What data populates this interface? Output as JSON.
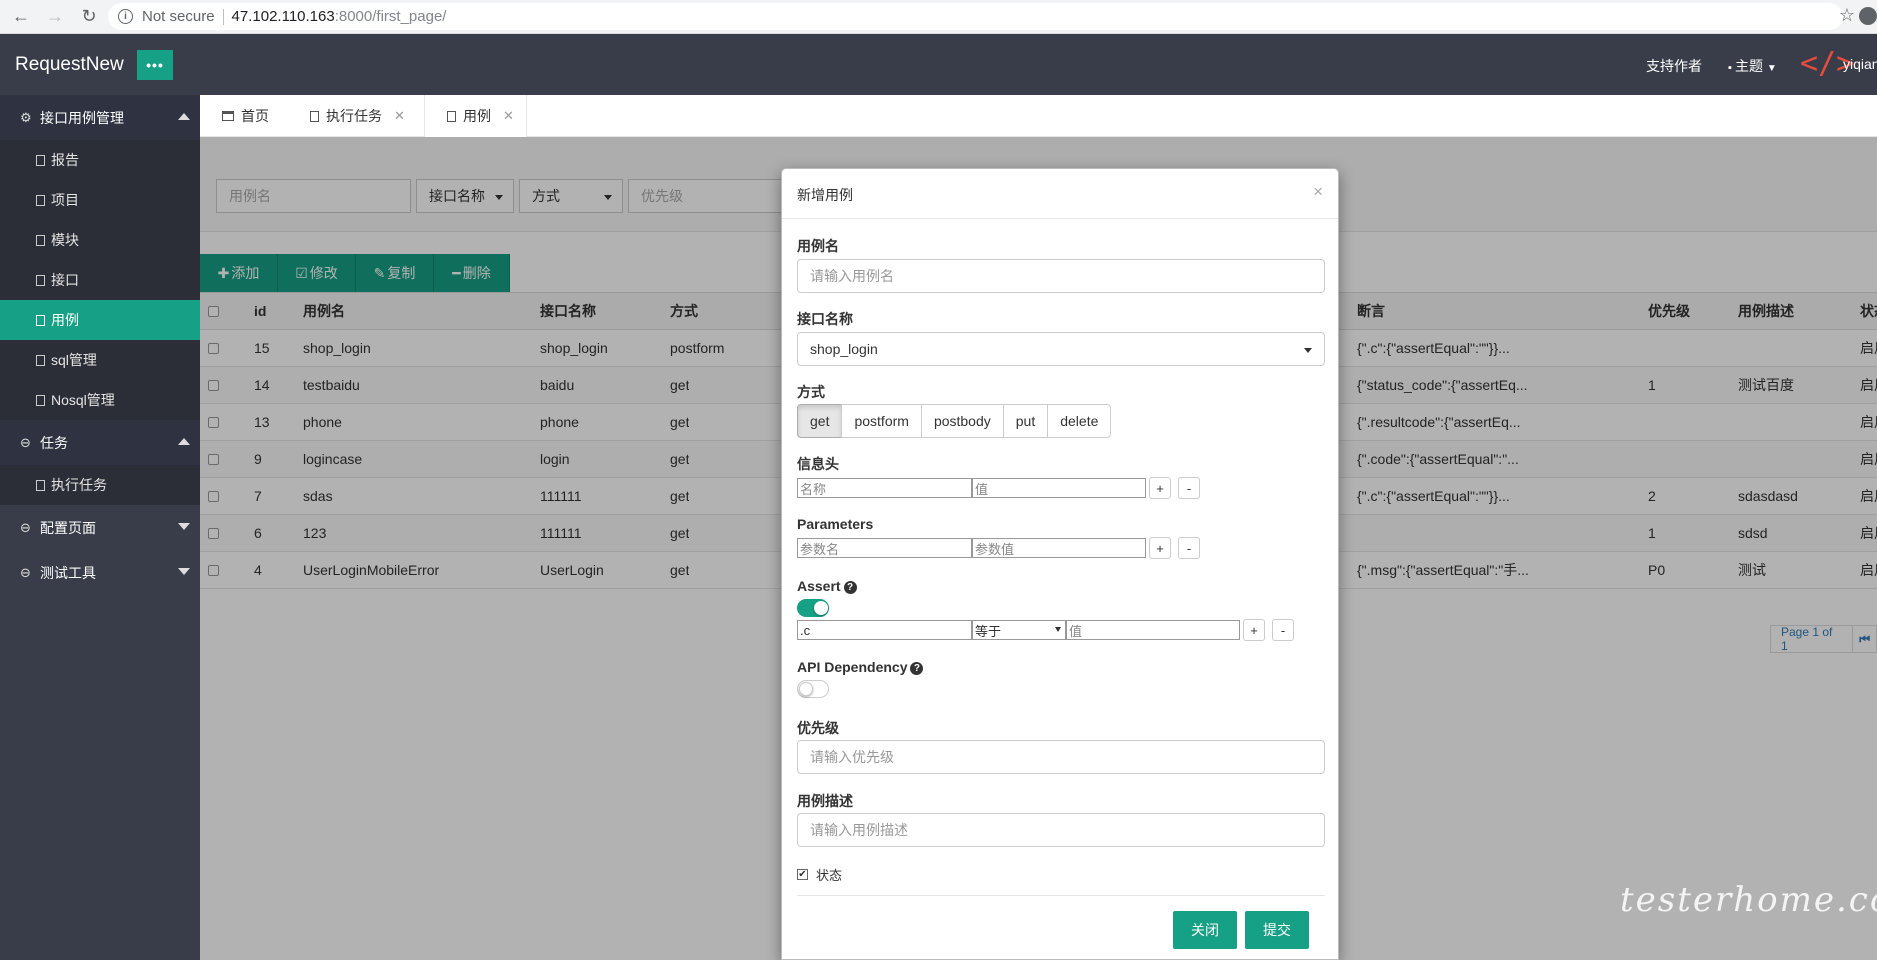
{
  "browser": {
    "not_secure": "Not secure",
    "url_host": "47.102.110.163",
    "url_path": ":8000/first_page/"
  },
  "header": {
    "brand": "RequestNew",
    "menu_toggle": "•••",
    "support": "支持作者",
    "theme": "主题",
    "logo_glyph": "</>",
    "user": "yiqian"
  },
  "sidebar": {
    "groups": [
      {
        "label": "接口用例管理",
        "items": [
          "报告",
          "项目",
          "模块",
          "接口",
          "用例",
          "sql管理",
          "Nosql管理"
        ]
      },
      {
        "label": "任务",
        "items": [
          "执行任务"
        ]
      },
      {
        "label": "配置页面"
      },
      {
        "label": "测试工具"
      }
    ]
  },
  "tabs": [
    {
      "label": "首页"
    },
    {
      "label": "执行任务"
    },
    {
      "label": "用例"
    }
  ],
  "filter": {
    "case_name_placeholder": "用例名",
    "api_name": "接口名称",
    "method": "方式",
    "priority_placeholder": "优先级"
  },
  "toolbar": {
    "add": "添加",
    "edit": "修改",
    "copy": "复制",
    "delete": "删除"
  },
  "table": {
    "headers": {
      "id": "id",
      "name": "用例名",
      "api": "接口名称",
      "method": "方式",
      "assert": "断言",
      "priority": "优先级",
      "desc": "用例描述",
      "status": "状态"
    },
    "rows": [
      {
        "id": "15",
        "name": "shop_login",
        "api": "shop_login",
        "method": "postform",
        "assert": "{\".c\":{\"assertEqual\":\"\"}}...",
        "priority": "",
        "desc": "",
        "status": "启用"
      },
      {
        "id": "14",
        "name": "testbaidu",
        "api": "baidu",
        "method": "get",
        "assert": "{\"status_code\":{\"assertEq...",
        "priority": "1",
        "desc": "测试百度",
        "status": "启用"
      },
      {
        "id": "13",
        "name": "phone",
        "api": "phone",
        "method": "get",
        "assert": "{\".resultcode\":{\"assertEq...",
        "priority": "",
        "desc": "",
        "status": "启用"
      },
      {
        "id": "9",
        "name": "logincase",
        "api": "login",
        "method": "get",
        "assert": "{\".code\":{\"assertEqual\":\"...",
        "priority": "",
        "desc": "",
        "status": "启用"
      },
      {
        "id": "7",
        "name": "sdas",
        "api": "111111",
        "method": "get",
        "assert": "{\".c\":{\"assertEqual\":\"\"}}...",
        "priority": "2",
        "desc": "sdasdasd",
        "status": "启用"
      },
      {
        "id": "6",
        "name": "123",
        "api": "111111",
        "method": "get",
        "assert": "",
        "priority": "1",
        "desc": "sdsd",
        "status": "启用"
      },
      {
        "id": "4",
        "name": "UserLoginMobileError",
        "api": "UserLogin",
        "method": "get",
        "assert": "{\".msg\":{\"assertEqual\":\"手...",
        "priority": "P0",
        "desc": "测试",
        "status": "启用"
      }
    ]
  },
  "pager": {
    "text": "Page 1 of 1",
    "first": "⏮"
  },
  "modal": {
    "title": "新增用例",
    "close": "×",
    "case_name_label": "用例名",
    "case_name_placeholder": "请输入用例名",
    "api_label": "接口名称",
    "api_value": "shop_login",
    "method_label": "方式",
    "methods": [
      "get",
      "postform",
      "postbody",
      "put",
      "delete"
    ],
    "selected_method": "get",
    "headers_label": "信息头",
    "header_name_placeholder": "名称",
    "header_value_placeholder": "值",
    "params_label": "Parameters",
    "param_name_placeholder": "参数名",
    "param_value_placeholder": "参数值",
    "assert_label": "Assert",
    "assert_enabled": true,
    "assert_key": ".c",
    "assert_op": "等于",
    "assert_value_placeholder": "值",
    "dep_label": "API Dependency",
    "dep_enabled": false,
    "priority_label": "优先级",
    "priority_placeholder": "请输入优先级",
    "desc_label": "用例描述",
    "desc_placeholder": "请输入用例描述",
    "status_label": "状态",
    "status_checked": true,
    "plus": "+",
    "minus": "-",
    "help": "?",
    "close_btn": "关闭",
    "submit_btn": "提交"
  },
  "watermark": "testerhome.com",
  "colors": {
    "accent": "#16a085",
    "header_bg": "#393d49"
  }
}
